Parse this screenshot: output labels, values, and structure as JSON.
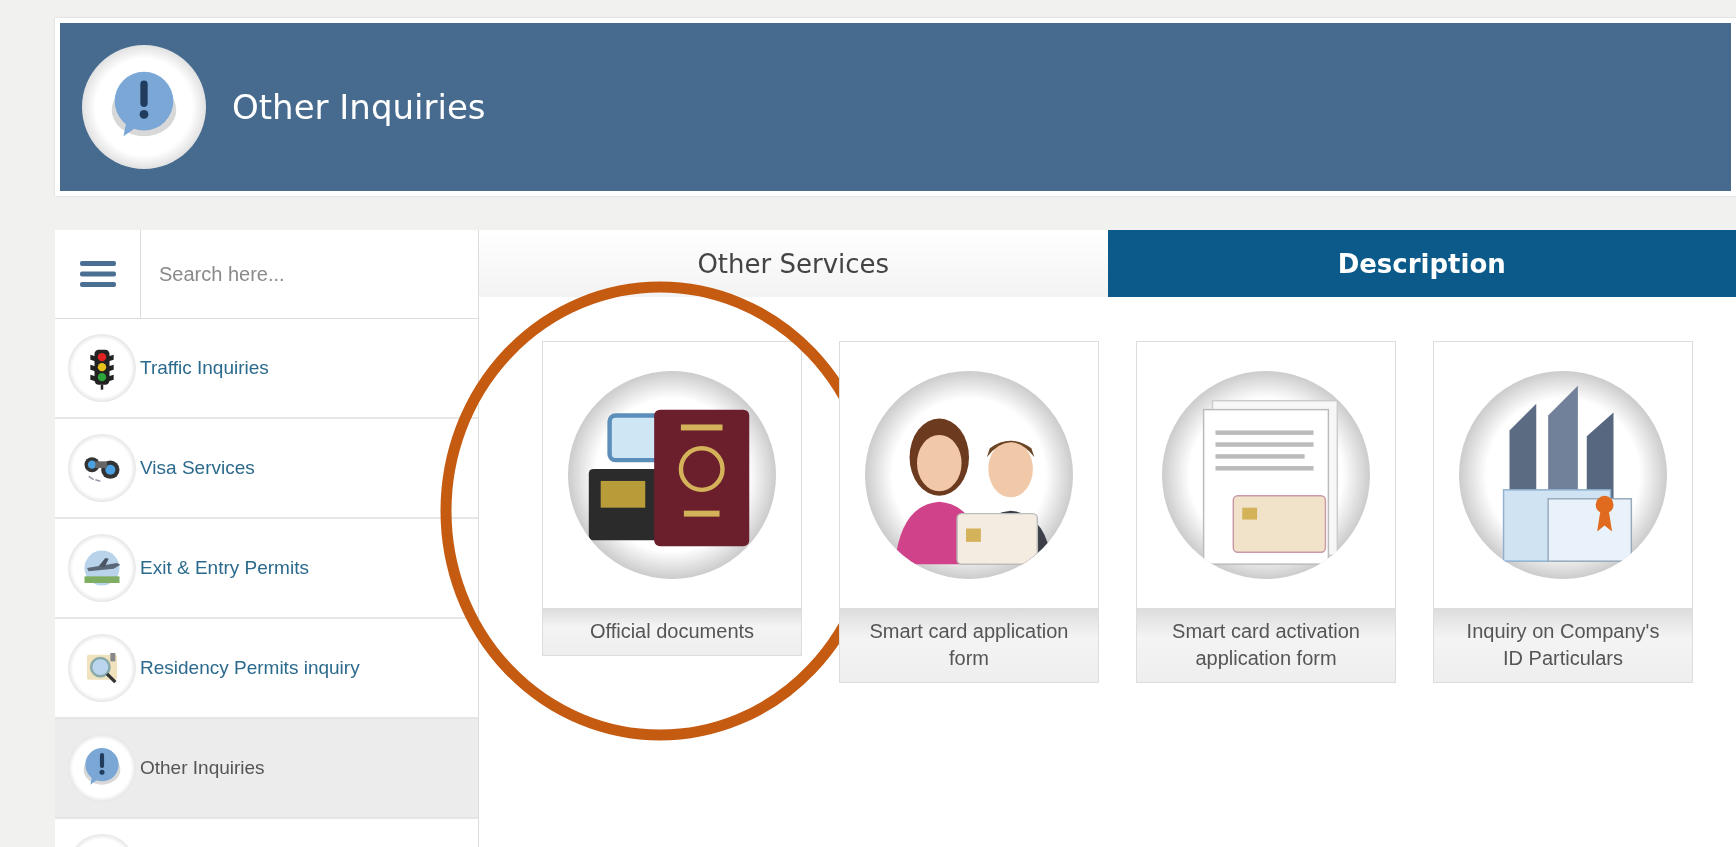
{
  "header": {
    "title": "Other Inquiries"
  },
  "sidebar": {
    "search": {
      "placeholder": "Search here..."
    },
    "items": [
      {
        "label": "Traffic Inquiries",
        "selected": false
      },
      {
        "label": "Visa Services",
        "selected": false
      },
      {
        "label": "Exit & Entry Permits",
        "selected": false
      },
      {
        "label": "Residency Permits inquiry",
        "selected": false
      },
      {
        "label": "Other Inquiries",
        "selected": true
      },
      {
        "selected": false
      }
    ]
  },
  "tabs": [
    {
      "label": "Other Services",
      "selected": false
    },
    {
      "label": "Description",
      "selected": true
    }
  ],
  "tiles": [
    {
      "label": "Official documents",
      "circled": true
    },
    {
      "label": "Smart card application form",
      "circled": false
    },
    {
      "label": "Smart card activation application form",
      "circled": false
    },
    {
      "label": "Inquiry on Company's ID Particulars",
      "circled": false
    }
  ]
}
